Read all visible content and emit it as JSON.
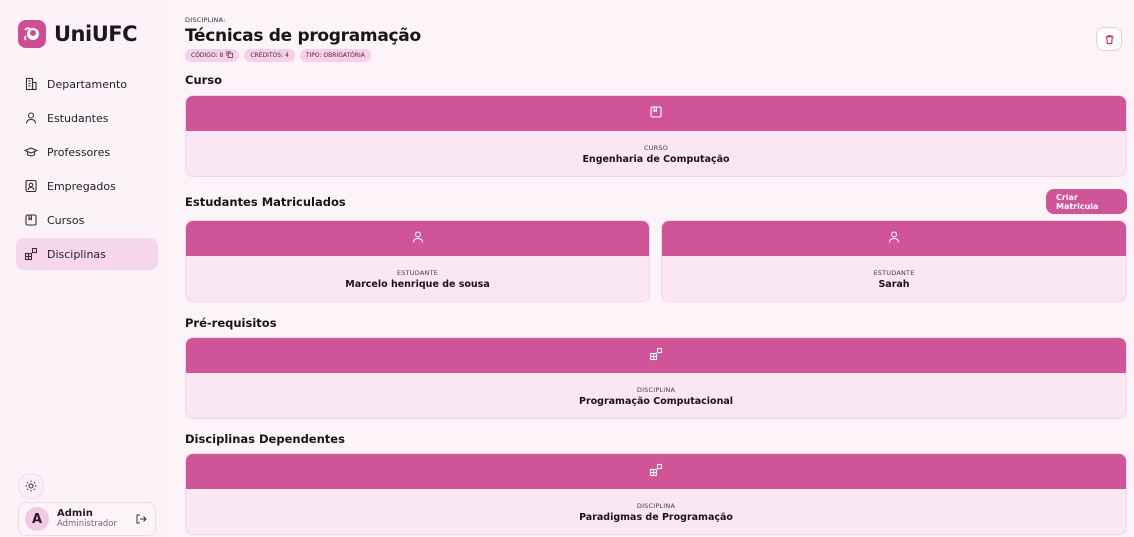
{
  "brand": {
    "name": "UniUFC"
  },
  "sidebar": {
    "items": [
      {
        "label": "Departamento",
        "icon": "building-icon"
      },
      {
        "label": "Estudantes",
        "icon": "user-icon"
      },
      {
        "label": "Professores",
        "icon": "graduation-cap-icon"
      },
      {
        "label": "Empregados",
        "icon": "id-badge-icon"
      },
      {
        "label": "Cursos",
        "icon": "book-icon"
      },
      {
        "label": "Disciplinas",
        "icon": "blocks-icon"
      }
    ],
    "active": "Disciplinas"
  },
  "user": {
    "initial": "A",
    "name": "Admin",
    "role": "Administrador"
  },
  "header": {
    "overline": "DISCIPLINA:",
    "title": "Técnicas de programação",
    "badges": {
      "codigo": "CÓDIGO: 8",
      "creditos": "CRÉDITOS: 4",
      "tipo": "TIPO: OBRIGATÓRIA"
    }
  },
  "sections": {
    "curso": {
      "title": "Curso",
      "card": {
        "label": "CURSO",
        "value": "Engenharia de Computação"
      }
    },
    "estudantes": {
      "title": "Estudantes Matriculados",
      "create_label": "Criar Matricula",
      "cards": [
        {
          "label": "ESTUDANTE",
          "value": "Marcelo henrique de sousa"
        },
        {
          "label": "ESTUDANTE",
          "value": "Sarah"
        }
      ]
    },
    "prerequisitos": {
      "title": "Pré-requisitos",
      "card": {
        "label": "DISCIPLINA",
        "value": "Programação Computacional"
      }
    },
    "dependentes": {
      "title": "Disciplinas Dependentes",
      "card": {
        "label": "DISCIPLINA",
        "value": "Paradigmas de Programação"
      }
    }
  },
  "colors": {
    "accent": "#cf5598",
    "card_bg": "#fbe6f4",
    "page_bg": "#fdf4fa"
  }
}
